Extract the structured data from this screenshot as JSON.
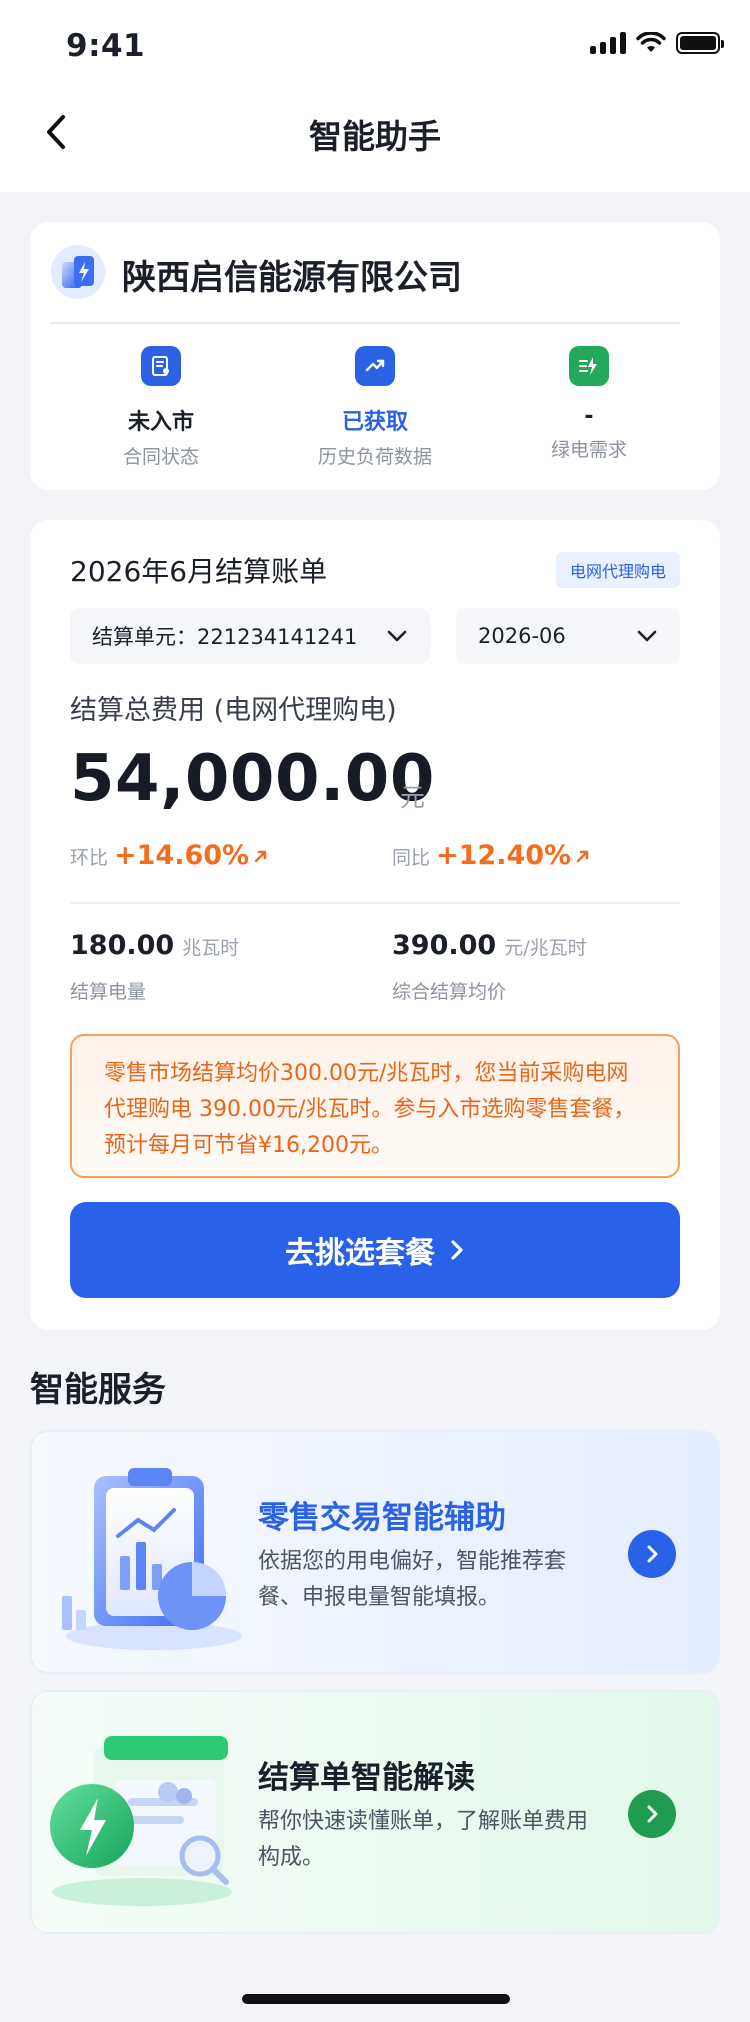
{
  "status_bar": {
    "time": "9:41"
  },
  "nav": {
    "title": "智能助手",
    "back_icon": "chevron-left-icon"
  },
  "company": {
    "name": "陕西启信能源有限公司",
    "stats": [
      {
        "value": "未入市",
        "label": "合同状态",
        "icon": "contract-doc-icon",
        "color": "#2b62e3",
        "value_color": "#1b1f2a"
      },
      {
        "value": "已获取",
        "label": "历史负荷数据",
        "icon": "trend-up-icon",
        "color": "#2b62e3",
        "value_color": "#2b62e3"
      },
      {
        "value": "-",
        "label": "绿电需求",
        "icon": "green-power-icon",
        "color": "#24a85a",
        "value_color": "#1b1f2a"
      }
    ]
  },
  "bill": {
    "title": "2026年6月结算账单",
    "tag": "电网代理购电",
    "unit_select": "结算单元：221234141241",
    "month_select": "2026-06",
    "fee_label": "结算总费用 (电网代理购电)",
    "fee_amount": "54,000.00",
    "fee_unit": "元",
    "mom_label": "环比",
    "mom_value": "+14.60%",
    "yoy_label": "同比",
    "yoy_value": "+12.40%",
    "energy_value": "180.00",
    "energy_unit": "兆瓦时",
    "energy_label": "结算电量",
    "price_value": "390.00",
    "price_unit": "元/兆瓦时",
    "price_label": "综合结算均价",
    "notice": "零售市场结算均价300.00元/兆瓦时，您当前采购电网代理购电 390.00元/兆瓦时。参与入市选购零售套餐，预计每月可节省¥16,200元。",
    "cta": "去挑选套餐",
    "colors": {
      "primary": "#2962e8",
      "increase": "#f46d1f"
    }
  },
  "services": {
    "title": "智能服务",
    "items": [
      {
        "title": "零售交易智能辅助",
        "desc": "依据您的用电偏好，智能推荐套餐、申报电量智能填报。",
        "title_color": "#2b62e3",
        "go_color": "#2962e8"
      },
      {
        "title": "结算单智能解读",
        "desc": "帮你快速读懂账单，了解账单费用构成。",
        "title_color": "#1b1f2a",
        "go_color": "#1f9c4e"
      }
    ]
  }
}
